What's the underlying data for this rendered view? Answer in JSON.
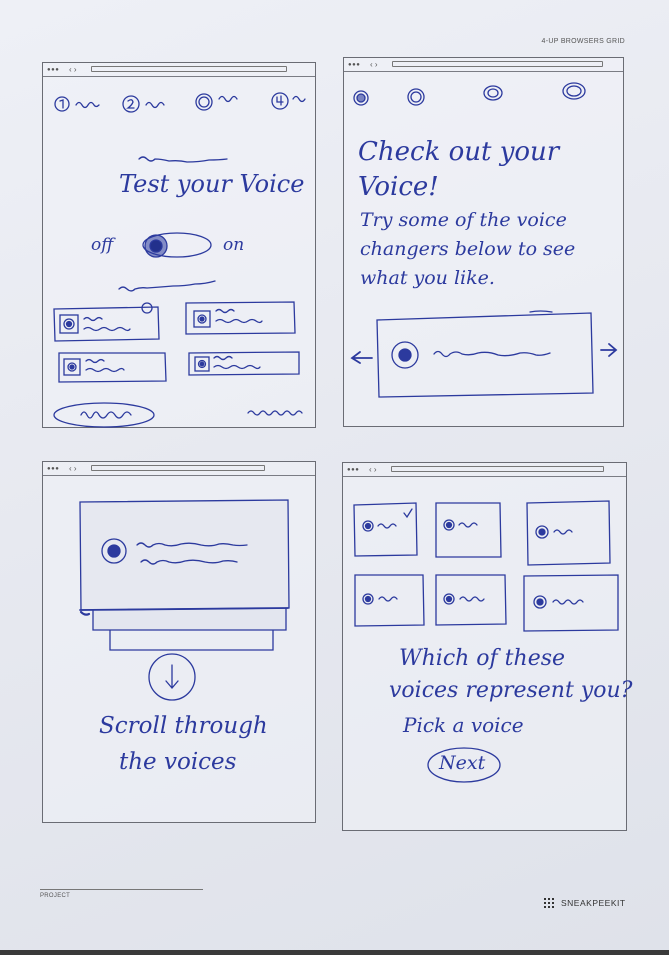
{
  "header": {
    "grid_title": "4-UP BROWSERS GRID"
  },
  "frame1": {
    "heading": "Test your Voice",
    "toggle_off": "off",
    "toggle_on": "on"
  },
  "frame2": {
    "line1": "Check out your",
    "line2": "Voice!",
    "line3": "Try some of the voice",
    "line4": "changers below to see",
    "line5": "what you like."
  },
  "frame3": {
    "line1": "Scroll through",
    "line2": "the voices"
  },
  "frame4": {
    "line1": "Which of these",
    "line2": "voices represent you?",
    "line3": "Pick a voice",
    "next_label": "Next"
  },
  "footer": {
    "project_label": "PROJECT",
    "brand": "SNEAKPEEKIT"
  },
  "colors": {
    "ink": "#2c3a9e",
    "pencil": "#555555",
    "paper": "#e9ebf2"
  }
}
